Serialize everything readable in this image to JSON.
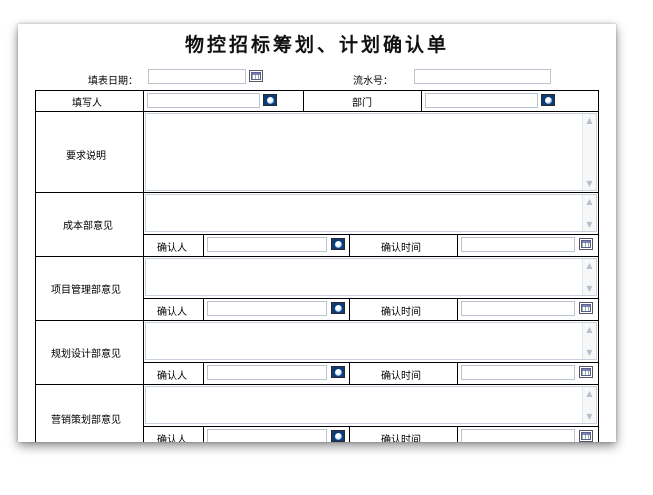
{
  "form": {
    "title": "物控招标筹划、计划确认单",
    "fill_date_label": "填表日期：",
    "serial_label": "流水号：",
    "filler_label": "填写人",
    "dept_label": "部门",
    "requirement_label": "要求说明",
    "sections": [
      {
        "label": "成本部意见",
        "confirmer_label": "确认人",
        "confirm_time_label": "确认时间"
      },
      {
        "label": "项目管理部意见",
        "confirmer_label": "确认人",
        "confirm_time_label": "确认时间"
      },
      {
        "label": "规划设计部意见",
        "confirmer_label": "确认人",
        "confirm_time_label": "确认时间"
      },
      {
        "label": "营销策划部意见",
        "confirmer_label": "确认人",
        "confirm_time_label": "确认时间"
      }
    ]
  },
  "icons": {
    "calendar": "calendar-icon",
    "select": "select-user-icon",
    "scroll_up": "scroll-up-icon",
    "scroll_down": "scroll-down-icon"
  },
  "glyphs": {
    "up": "▲",
    "down": "▼"
  }
}
